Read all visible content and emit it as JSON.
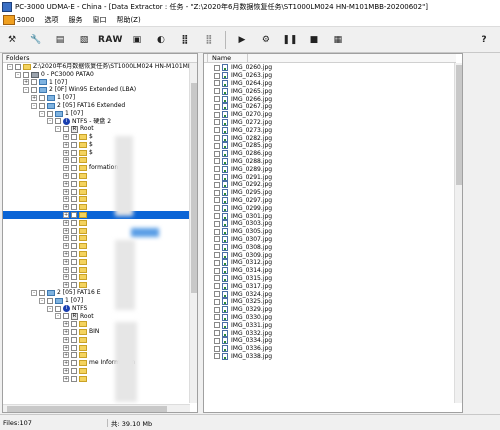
{
  "window": {
    "title": "PC-3000 UDMA-E - China - [Data Extractor : 任务 - \"Z:\\2020年6月数据恢复任务\\ST1000LM024 HN-M101MBB-20200602\"]"
  },
  "menu": {
    "items": [
      "PC-3000",
      "选项",
      "服务",
      "窗口",
      "帮助(Z)"
    ]
  },
  "toolbar": {
    "raw_label": "RAW",
    "icons": [
      "tools-icon",
      "wrench-icon",
      "open-icon",
      "map-icon",
      "raw",
      "chip-icon",
      "head-icon",
      "cluster-icon",
      "cluster-grey-icon",
      "play-icon",
      "bike-icon",
      "pause-icon",
      "stop-icon",
      "calculator-icon",
      "help-icon"
    ]
  },
  "left_panel": {
    "header": "Folders",
    "tree": [
      {
        "indent": 1,
        "text": "Z:\\2020年6月数据恢复任务\\ST1000LM024 HN-M101MBB",
        "icon": "folder",
        "exp": "-"
      },
      {
        "indent": 2,
        "text": "0 - PC3000 PATA0",
        "icon": "drive",
        "exp": "-"
      },
      {
        "indent": 3,
        "text": "1 [07]",
        "icon": "part",
        "exp": "+"
      },
      {
        "indent": 3,
        "text": "2 [0F] Win95 Extended (LBA)",
        "icon": "part",
        "exp": "-"
      },
      {
        "indent": 4,
        "text": "1 [07]",
        "icon": "part",
        "exp": "+"
      },
      {
        "indent": 4,
        "text": "2 [05] FAT16 Extended",
        "icon": "part",
        "exp": "-"
      },
      {
        "indent": 5,
        "text": "1 [07]",
        "icon": "part",
        "exp": "-"
      },
      {
        "indent": 6,
        "text": "NTFS - 硬盘 2",
        "icon": "ntfs",
        "exp": "-"
      },
      {
        "indent": 7,
        "text": "Root",
        "icon": "root",
        "exp": "-"
      },
      {
        "indent": 8,
        "text": "$",
        "icon": "folder",
        "exp": "+"
      },
      {
        "indent": 8,
        "text": "$",
        "icon": "folder",
        "exp": "+"
      },
      {
        "indent": 8,
        "text": "$",
        "icon": "folder",
        "exp": "+"
      },
      {
        "indent": 8,
        "text": "",
        "icon": "folder",
        "exp": "+"
      },
      {
        "indent": 8,
        "text": "formation",
        "icon": "folder",
        "exp": "+"
      },
      {
        "indent": 8,
        "text": "",
        "icon": "folder",
        "exp": "+"
      },
      {
        "indent": 8,
        "text": "",
        "icon": "folder",
        "exp": "+"
      },
      {
        "indent": 8,
        "text": "",
        "icon": "folder",
        "exp": "+"
      },
      {
        "indent": 8,
        "text": "",
        "icon": "folder",
        "exp": "+"
      },
      {
        "indent": 8,
        "text": "",
        "icon": "folder",
        "exp": "+"
      },
      {
        "indent": 8,
        "text": "",
        "icon": "folder",
        "exp": "+",
        "selected": true
      },
      {
        "indent": 8,
        "text": "",
        "icon": "folder",
        "exp": "+"
      },
      {
        "indent": 8,
        "text": "",
        "icon": "folder",
        "exp": "+"
      },
      {
        "indent": 8,
        "text": "",
        "icon": "folder",
        "exp": "+"
      },
      {
        "indent": 8,
        "text": "",
        "icon": "folder",
        "exp": "+"
      },
      {
        "indent": 8,
        "text": "",
        "icon": "folder",
        "exp": "+"
      },
      {
        "indent": 8,
        "text": "",
        "icon": "folder",
        "exp": "+"
      },
      {
        "indent": 8,
        "text": "",
        "icon": "folder",
        "exp": "+"
      },
      {
        "indent": 8,
        "text": "",
        "icon": "folder",
        "exp": "+"
      },
      {
        "indent": 8,
        "text": "",
        "icon": "folder",
        "exp": "+"
      },
      {
        "indent": 4,
        "text": "2 [05] FAT16 E",
        "icon": "part",
        "exp": "-"
      },
      {
        "indent": 5,
        "text": "1 [07]",
        "icon": "part",
        "exp": "-"
      },
      {
        "indent": 6,
        "text": "NTFS",
        "icon": "ntfs",
        "exp": "-"
      },
      {
        "indent": 7,
        "text": "Root",
        "icon": "root",
        "exp": "-"
      },
      {
        "indent": 8,
        "text": "",
        "icon": "folder",
        "exp": "+"
      },
      {
        "indent": 8,
        "text": "BIN",
        "icon": "folder",
        "exp": "+"
      },
      {
        "indent": 8,
        "text": "",
        "icon": "folder",
        "exp": "+"
      },
      {
        "indent": 8,
        "text": "",
        "icon": "folder",
        "exp": "+"
      },
      {
        "indent": 8,
        "text": "",
        "icon": "folder",
        "exp": "+"
      },
      {
        "indent": 8,
        "text": "me Information",
        "icon": "folder",
        "exp": "+"
      },
      {
        "indent": 8,
        "text": "",
        "icon": "folder",
        "exp": "+"
      },
      {
        "indent": 8,
        "text": "",
        "icon": "folder",
        "exp": "+"
      }
    ]
  },
  "right_panel": {
    "column_name": "Name",
    "files": [
      "IMG_0260.jpg",
      "IMG_0263.jpg",
      "IMG_0264.jpg",
      "IMG_0265.jpg",
      "IMG_0266.jpg",
      "IMG_0267.jpg",
      "IMG_0270.jpg",
      "IMG_0272.jpg",
      "IMG_0273.jpg",
      "IMG_0282.jpg",
      "IMG_0285.jpg",
      "IMG_0286.jpg",
      "IMG_0288.jpg",
      "IMG_0289.jpg",
      "IMG_0291.jpg",
      "IMG_0292.jpg",
      "IMG_0295.jpg",
      "IMG_0297.jpg",
      "IMG_0299.jpg",
      "IMG_0301.jpg",
      "IMG_0303.jpg",
      "IMG_0305.jpg",
      "IMG_0307.jpg",
      "IMG_0308.jpg",
      "IMG_0309.jpg",
      "IMG_0312.jpg",
      "IMG_0314.jpg",
      "IMG_0315.jpg",
      "IMG_0317.jpg",
      "IMG_0324.jpg",
      "IMG_0325.jpg",
      "IMG_0329.jpg",
      "IMG_0330.jpg",
      "IMG_0331.jpg",
      "IMG_0332.jpg",
      "IMG_0334.jpg",
      "IMG_0336.jpg",
      "IMG_0338.jpg"
    ]
  },
  "status": {
    "left": "Files:107",
    "right": "共: 39.10 Mb"
  }
}
